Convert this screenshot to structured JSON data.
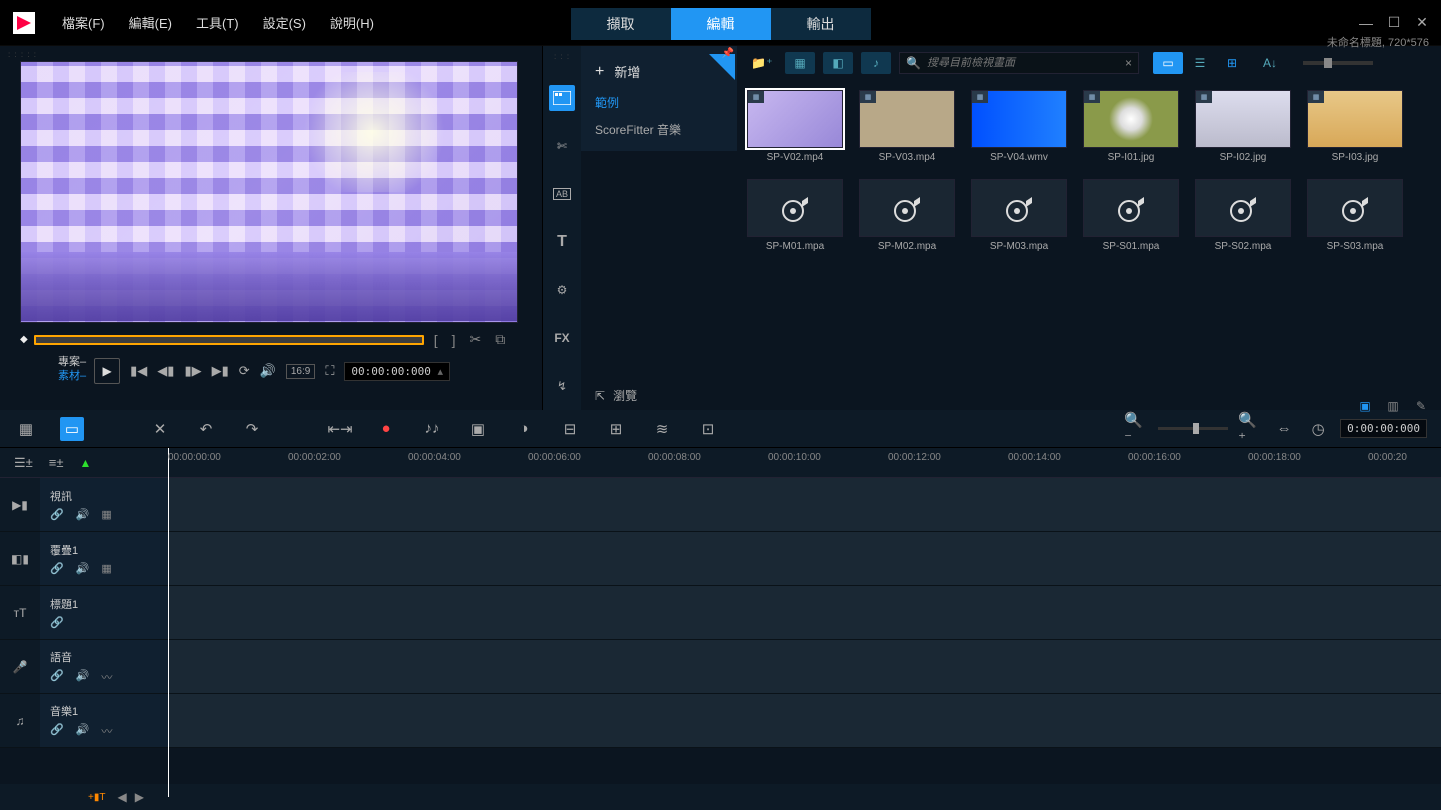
{
  "titleInfo": "未命名標題, 720*576",
  "menu": {
    "file": "檔案(F)",
    "edit": "編輯(E)",
    "tools": "工具(T)",
    "settings": "設定(S)",
    "help": "說明(H)"
  },
  "modes": {
    "capture": "擷取",
    "edit": "編輯",
    "output": "輸出"
  },
  "preview": {
    "project": "專案–",
    "material": "素材–",
    "aspect": "16:9",
    "timecode": "00:00:00:000"
  },
  "library": {
    "addNew": "新增",
    "folders": {
      "examples": "範例",
      "scorefitter": "ScoreFitter 音樂"
    },
    "browse": "瀏覽",
    "search": {
      "placeholder": "搜尋目前檢視畫面"
    },
    "items": [
      {
        "name": "SP-V02.mp4",
        "type": "video",
        "bg": "linear-gradient(135deg,#c8b8f0,#9888d8)",
        "selected": true
      },
      {
        "name": "SP-V03.mp4",
        "type": "video",
        "bg": "#b8a888"
      },
      {
        "name": "SP-V04.wmv",
        "type": "video",
        "bg": "linear-gradient(90deg,#0050ff,#2080ff)"
      },
      {
        "name": "SP-I01.jpg",
        "type": "image",
        "bg": "radial-gradient(circle,#fff,#ddd 20%,#8a9a4a 40%)"
      },
      {
        "name": "SP-I02.jpg",
        "type": "image",
        "bg": "linear-gradient(#dde,#bbc)"
      },
      {
        "name": "SP-I03.jpg",
        "type": "image",
        "bg": "linear-gradient(#e8c888,#d8a858)"
      },
      {
        "name": "SP-M01.mpa",
        "type": "audio"
      },
      {
        "name": "SP-M02.mpa",
        "type": "audio"
      },
      {
        "name": "SP-M03.mpa",
        "type": "audio"
      },
      {
        "name": "SP-S01.mpa",
        "type": "audio"
      },
      {
        "name": "SP-S02.mpa",
        "type": "audio"
      },
      {
        "name": "SP-S03.mpa",
        "type": "audio"
      }
    ]
  },
  "timeline": {
    "timecode": "0:00:00:000",
    "ticks": [
      "00:00:00:00",
      "00:00:02:00",
      "00:00:04:00",
      "00:00:06:00",
      "00:00:08:00",
      "00:00:10:00",
      "00:00:12:00",
      "00:00:14:00",
      "00:00:16:00",
      "00:00:18:00",
      "00:00:20"
    ],
    "tracks": [
      {
        "name": "視訊",
        "icon": "video",
        "ctrls": [
          "link",
          "vol",
          "grid"
        ]
      },
      {
        "name": "覆疊1",
        "icon": "overlay",
        "ctrls": [
          "link",
          "vol",
          "grid"
        ]
      },
      {
        "name": "標題1",
        "icon": "title",
        "ctrls": [
          "link"
        ]
      },
      {
        "name": "語音",
        "icon": "voice",
        "ctrls": [
          "link",
          "vol",
          "wave"
        ]
      },
      {
        "name": "音樂1",
        "icon": "music",
        "ctrls": [
          "link",
          "vol",
          "wave"
        ]
      }
    ]
  }
}
